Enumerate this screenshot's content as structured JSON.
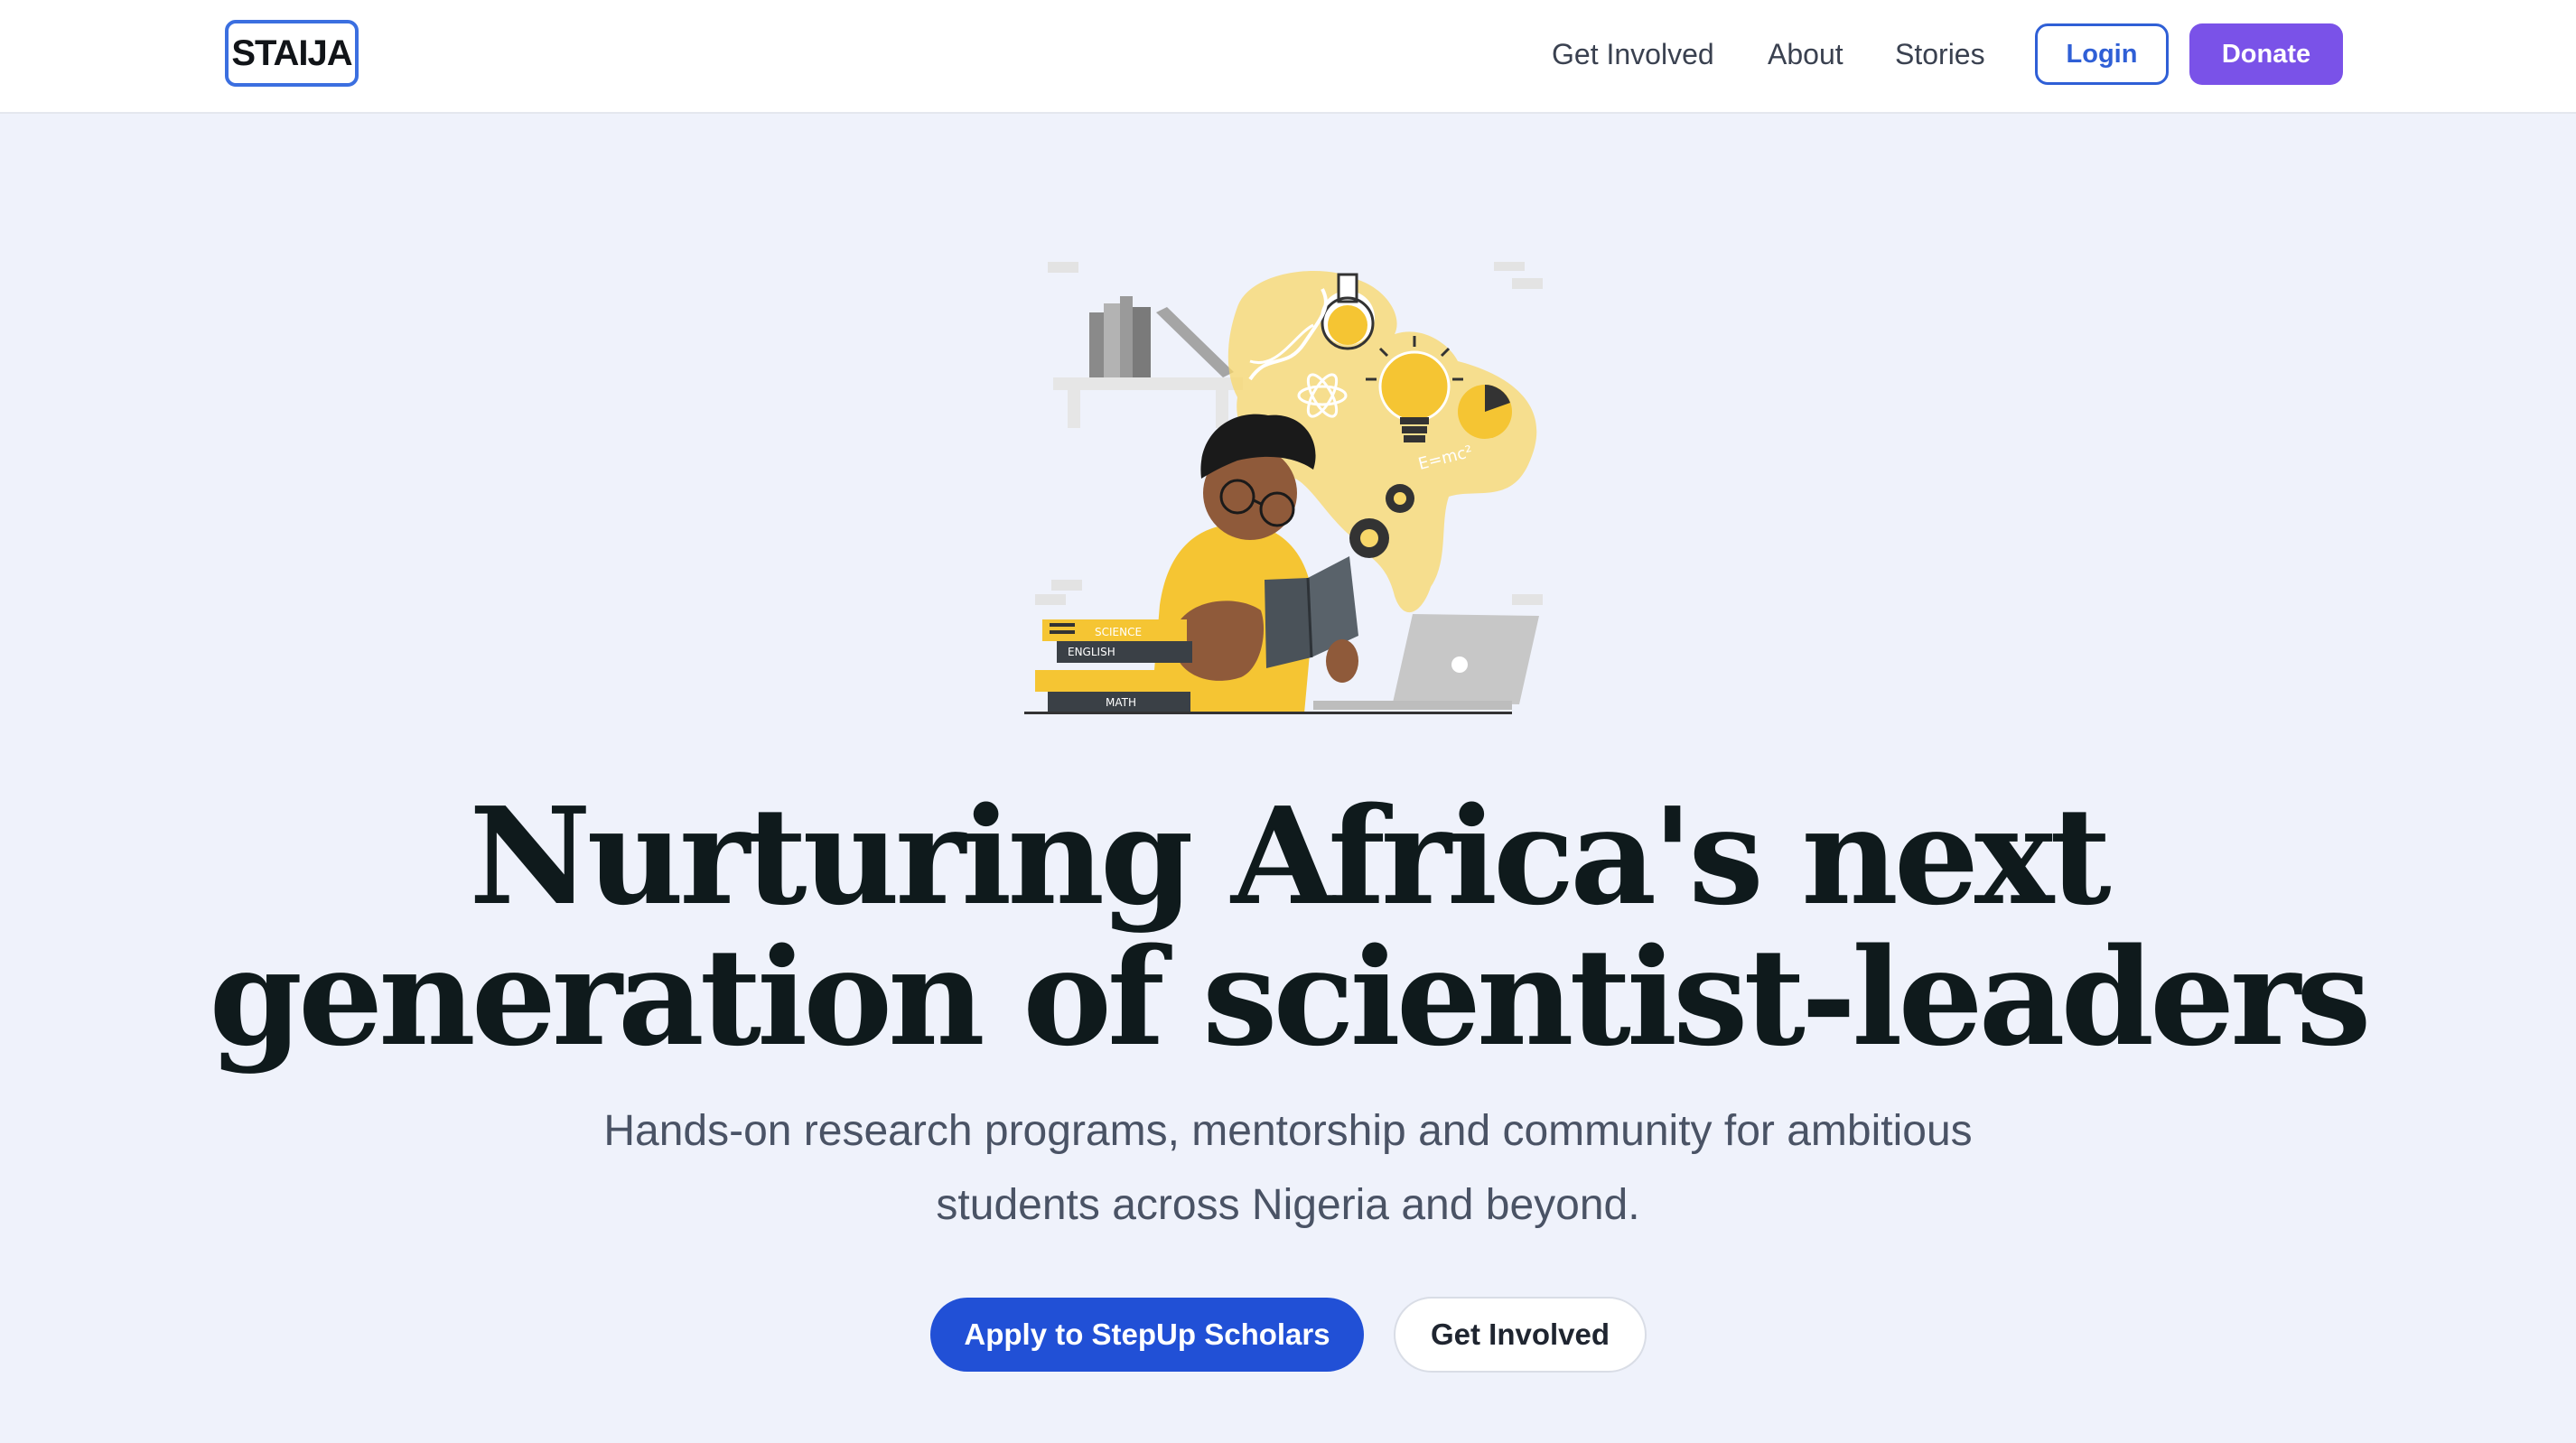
{
  "header": {
    "logo_text": "STAIJA",
    "nav": {
      "get_involved": "Get Involved",
      "about": "About",
      "stories": "Stories"
    },
    "login_label": "Login",
    "donate_label": "Donate"
  },
  "hero": {
    "illustration": {
      "icon": "student-reading-illustration",
      "book_labels": [
        "SCIENCE",
        "ENGLISH",
        "MATH"
      ],
      "formula": "E=mc²"
    },
    "headline_line1": "Nurturing Africa's next",
    "headline_line2": "generation of scientist-leaders",
    "subtitle_line1": "Hands-on research programs, mentorship and community for ambitious",
    "subtitle_line2": "students across Nigeria and beyond.",
    "primary_cta": "Apply to StepUp Scholars",
    "secondary_cta": "Get Involved"
  },
  "colors": {
    "page_background": "#eff2fb",
    "primary_blue": "#2150d6",
    "donate_purple": "#7a52e8",
    "illustration_yellow": "#f5c533",
    "headline": "#0f1a1c"
  }
}
